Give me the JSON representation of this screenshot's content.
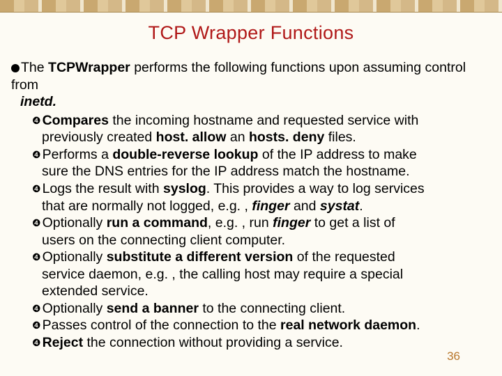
{
  "title": "TCP Wrapper Functions",
  "intro": {
    "pre": "The ",
    "term": "TCPWrapper",
    "mid": " performs the following functions upon assuming control from ",
    "term2": "inetd."
  },
  "items": [
    {
      "segments": [
        [
          "b",
          "Compares"
        ],
        [
          "",
          " the incoming hostname and requested service with"
        ]
      ],
      "cont_segments": [
        [
          "",
          "previously created "
        ],
        [
          "b",
          "host. allow"
        ],
        [
          "",
          " an "
        ],
        [
          "b",
          "hosts. deny"
        ],
        [
          "",
          " files."
        ]
      ]
    },
    {
      "segments": [
        [
          "",
          "Performs a "
        ],
        [
          "b",
          "double-reverse lookup"
        ],
        [
          "",
          " of the IP address to make"
        ]
      ],
      "cont_segments": [
        [
          "",
          "sure the DNS entries for the IP address match the hostname."
        ]
      ]
    },
    {
      "segments": [
        [
          "",
          "Logs the result with "
        ],
        [
          "b",
          "syslog"
        ],
        [
          "",
          ". This provides a way to log services"
        ]
      ],
      "cont_segments": [
        [
          "",
          "that are normally not logged, e.g. , "
        ],
        [
          "bi",
          "finger"
        ],
        [
          "",
          " and "
        ],
        [
          "bi",
          "systat"
        ],
        [
          "",
          "."
        ]
      ]
    },
    {
      "segments": [
        [
          "",
          "Optionally "
        ],
        [
          "b",
          "run a command"
        ],
        [
          "",
          ", e.g. , run "
        ],
        [
          "bi",
          "finger"
        ],
        [
          "",
          " to get a list of"
        ]
      ],
      "cont_segments": [
        [
          "",
          "users on the connecting client computer."
        ]
      ]
    },
    {
      "segments": [
        [
          "",
          "Optionally "
        ],
        [
          "b",
          "substitute a different version"
        ],
        [
          "",
          " of the requested"
        ]
      ],
      "cont_segments": [
        [
          "",
          "service daemon, e.g. , the calling host may require a special"
        ]
      ],
      "cont2_segments": [
        [
          "",
          "extended service."
        ]
      ]
    },
    {
      "segments": [
        [
          "",
          "Optionally "
        ],
        [
          "b",
          "send a banner"
        ],
        [
          "",
          " to the connecting client."
        ]
      ]
    },
    {
      "segments": [
        [
          "",
          "Passes control of the connection to the "
        ],
        [
          "b",
          "real network daemon"
        ],
        [
          "",
          "."
        ]
      ]
    },
    {
      "segments": [
        [
          "b",
          "Reject"
        ],
        [
          "",
          " the connection without providing a service."
        ]
      ]
    }
  ],
  "pageNumber": "36",
  "subBullet": "❹"
}
